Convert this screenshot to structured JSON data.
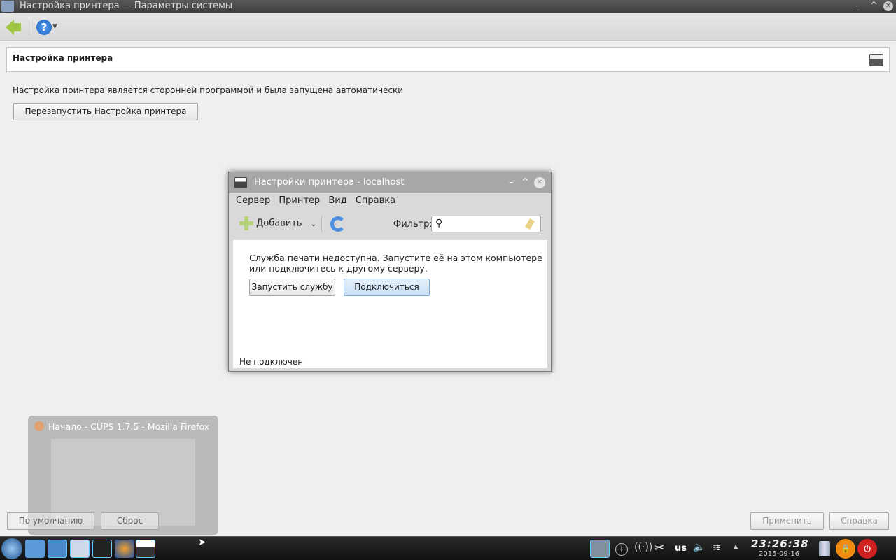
{
  "window": {
    "title": "Настройка принтера — Параметры системы"
  },
  "toolbar": {
    "back": "back-icon",
    "help": "help-icon"
  },
  "header": {
    "title": "Настройка принтера"
  },
  "main": {
    "message": "Настройка принтера является сторонней программой и была запущена автоматически",
    "restart_button": "Перезапустить Настройка принтера"
  },
  "dialog": {
    "title": "Настройки принтера - localhost",
    "menu": [
      "Сервер",
      "Принтер",
      "Вид",
      "Справка"
    ],
    "add_label": "Добавить",
    "filter_label": "Фильтр:",
    "filter_value": "",
    "message": "Служба печати недоступна. Запустите её на этом компьютере или подключитесь к другому серверу.",
    "start_button": "Запустить службу",
    "connect_button": "Подключиться",
    "status": "Не подключен"
  },
  "footer": {
    "defaults": "По умолчанию",
    "reset": "Сброс",
    "apply": "Применить",
    "help": "Справка"
  },
  "preview": {
    "title": "Начало - CUPS 1.7.5 - Mozilla Firefox"
  },
  "tray": {
    "keyboard": "us",
    "time": "23:26:38",
    "date": "2015-09-16"
  }
}
